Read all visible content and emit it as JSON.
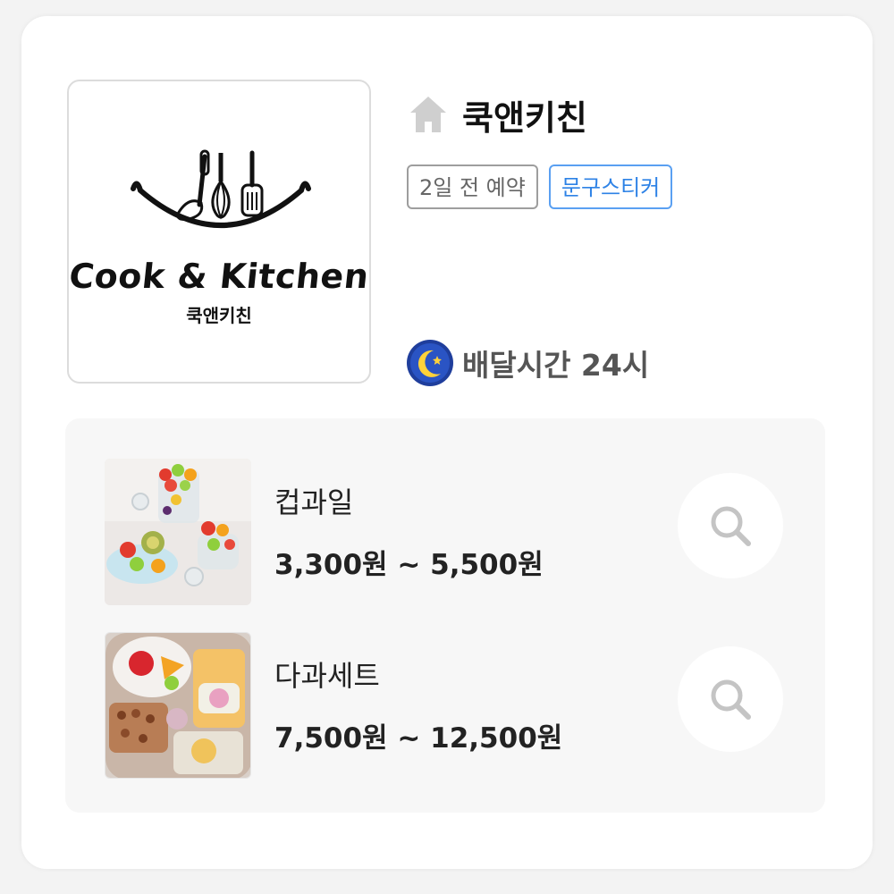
{
  "store": {
    "name": "쿡앤키친",
    "logo_text_en": "Cook & Kitchen",
    "logo_text_ko": "쿡앤키친",
    "tags": [
      {
        "label": "2일 전 예약",
        "style": "gray"
      },
      {
        "label": "문구스티커",
        "style": "blue"
      }
    ],
    "delivery": "배달시간 24시",
    "icons": {
      "home": "home-icon",
      "delivery": "moon-icon"
    }
  },
  "products": [
    {
      "name": "컵과일",
      "price": "3,300원 ~ 5,500원",
      "icon": "search-icon"
    },
    {
      "name": "다과세트",
      "price": "7,500원 ~ 12,500원",
      "icon": "search-icon"
    }
  ],
  "colors": {
    "accent_blue": "#2d82e6",
    "tag_gray": "#9e9e9e",
    "panel_bg": "#f7f7f7"
  }
}
